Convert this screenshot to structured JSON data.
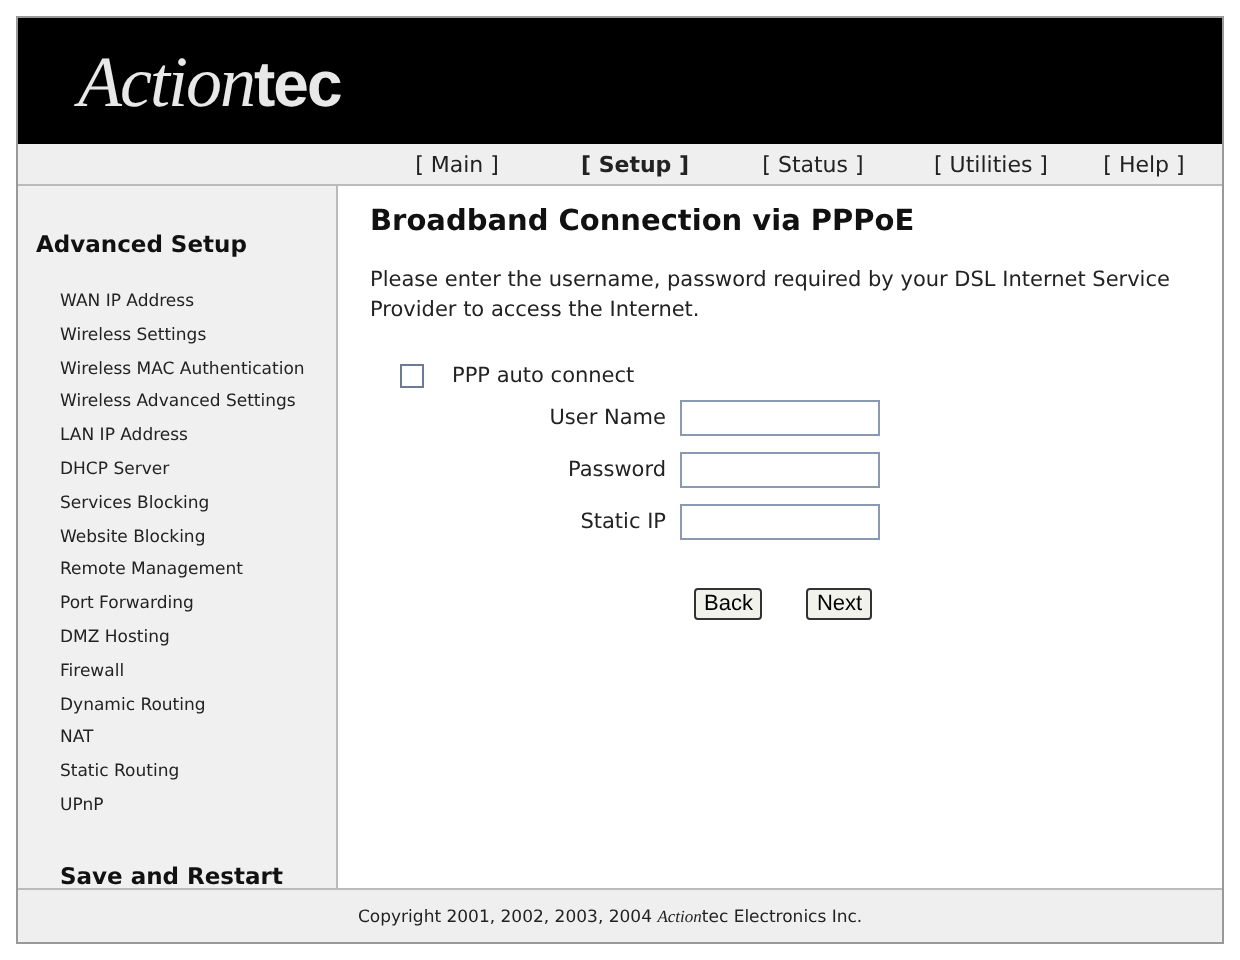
{
  "header": {
    "logo": {
      "script": "Action",
      "plain": "tec"
    }
  },
  "nav": [
    {
      "label": "[ Main ]",
      "selected": false
    },
    {
      "label": "[ Setup ]",
      "selected": true
    },
    {
      "label": "[ Status ]",
      "selected": false
    },
    {
      "label": "[ Utilities ]",
      "selected": false
    },
    {
      "label": "[ Help ]",
      "selected": false
    }
  ],
  "sidebar": {
    "heading": "Advanced Setup",
    "items": [
      "WAN IP Address",
      "Wireless Settings",
      "Wireless MAC Authentication",
      "Wireless Advanced Settings",
      "LAN IP Address",
      "DHCP Server",
      "Services Blocking",
      "Website Blocking",
      "Remote Management",
      "Port Forwarding",
      "DMZ Hosting",
      "Firewall",
      "Dynamic Routing",
      "NAT",
      "Static Routing",
      "UPnP"
    ],
    "footer_link": "Save and Restart"
  },
  "content": {
    "title": "Broadband Connection via PPPoE",
    "description": "Please enter the username, password required by your DSL Internet Service Provider to access the Internet.",
    "auto_connect": {
      "label": "PPP auto connect",
      "checked": false
    },
    "fields": [
      {
        "label": "User Name"
      },
      {
        "label": "Password"
      },
      {
        "label": "Static IP"
      }
    ],
    "buttons": [
      "Back",
      "Next"
    ]
  },
  "footer": {
    "copyright": {
      "before": "Copyright 2001, 2002, 2003, 2004 ",
      "script": "Action",
      "after": "tec Electronics Inc."
    }
  }
}
